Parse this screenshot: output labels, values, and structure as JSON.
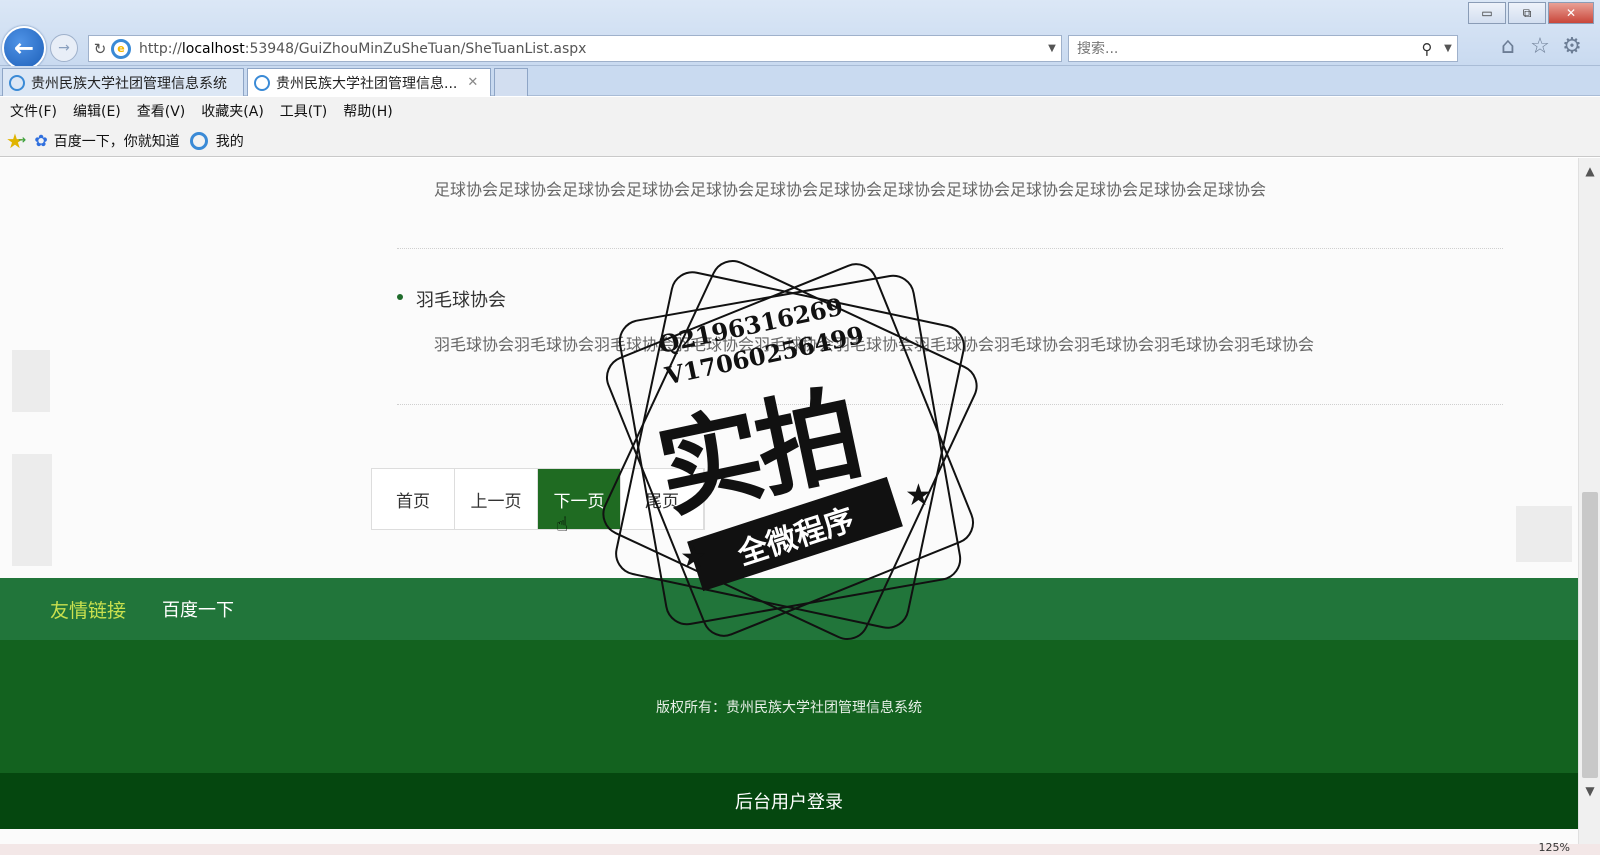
{
  "browser": {
    "window_buttons": {
      "minimize": "▭",
      "restore": "⧉",
      "close": "✕"
    },
    "address_url_prefix": "http://",
    "address_url_host": "localhost",
    "address_url_rest": ":53948/GuiZhouMinZuSheTuan/SheTuanList.aspx",
    "search_placeholder": "搜索...",
    "tabs": [
      {
        "label": "贵州民族大学社团管理信息系统"
      },
      {
        "label": "贵州民族大学社团管理信息..."
      }
    ],
    "menu": [
      "文件(F)",
      "编辑(E)",
      "查看(V)",
      "收藏夹(A)",
      "工具(T)",
      "帮助(H)"
    ],
    "favorites": [
      {
        "label": "百度一下，你就知道",
        "icon": "baidu-paw-icon"
      },
      {
        "label": "我的",
        "icon": "ie-icon"
      }
    ],
    "zoom_label": "125%"
  },
  "content": {
    "football_desc": "足球协会足球协会足球协会足球协会足球协会足球协会足球协会足球协会足球协会足球协会足球协会足球协会足球协会",
    "badminton_title": "羽毛球协会",
    "badminton_desc": "羽毛球协会羽毛球协会羽毛球协会羽毛球协会羽毛球协会羽毛球协会羽毛球协会羽毛球协会羽毛球协会羽毛球协会羽毛球协会"
  },
  "pager": {
    "first": "首页",
    "prev": "上一页",
    "next": "下一页",
    "last": "尾页",
    "current": "next"
  },
  "footer": {
    "friendlinks_title": "友情链接",
    "friendlink_baidu": "百度一下",
    "copyright": "版权所有：贵州民族大学社团管理信息系统",
    "admin_login": "后台用户登录"
  },
  "watermark": {
    "qq": "Q2196316269",
    "wechat": "V17060256499",
    "big": "实拍",
    "ribbon": "全微程序"
  },
  "colors": {
    "friendlinks_bg": "#21753a",
    "copyright_bg": "#13621f",
    "admin_bg": "#05470f",
    "pager_active": "#1f6b22",
    "friendlinks_title": "#c9e04e"
  }
}
